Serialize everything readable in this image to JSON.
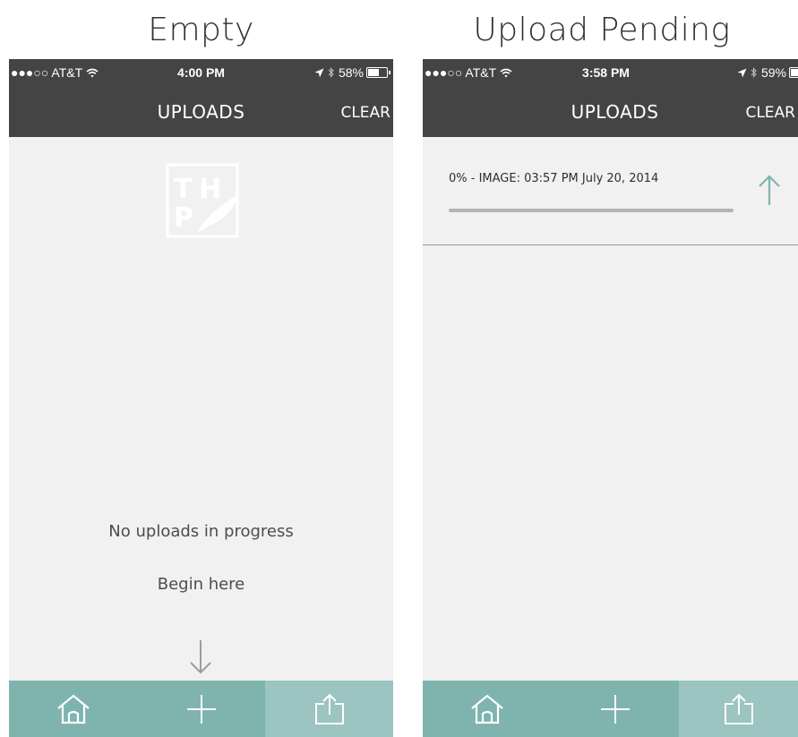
{
  "panels": [
    {
      "title": "Empty",
      "status": {
        "carrier": "●●●○○ AT&T",
        "time": "4:00 PM",
        "battery": "58%",
        "battery_level": 0.58
      },
      "nav": {
        "title": "UPLOADS",
        "clear_label": "CLEAR"
      },
      "empty": {
        "message": "No uploads in progress",
        "hint": "Begin here"
      },
      "logo_letters": [
        "T",
        "H",
        "P"
      ]
    },
    {
      "title": "Upload Pending",
      "status": {
        "carrier": "●●●○○ AT&T",
        "time": "3:58 PM",
        "battery": "59%",
        "battery_level": 0.59
      },
      "nav": {
        "title": "UPLOADS",
        "clear_label": "CLEAR"
      },
      "upload": {
        "label": "0% - IMAGE: 03:57 PM July 20, 2014",
        "progress": 0.0
      }
    }
  ],
  "tabs": [
    {
      "icon": "home-icon"
    },
    {
      "icon": "plus-icon"
    },
    {
      "icon": "share-upload-icon",
      "active": true
    }
  ],
  "colors": {
    "bar_dark": "#444444",
    "background": "#f0f1f0",
    "tab_bar": "#7fb4ae",
    "tab_active": "#9cc4c0",
    "accent": "#7fb4ae"
  }
}
